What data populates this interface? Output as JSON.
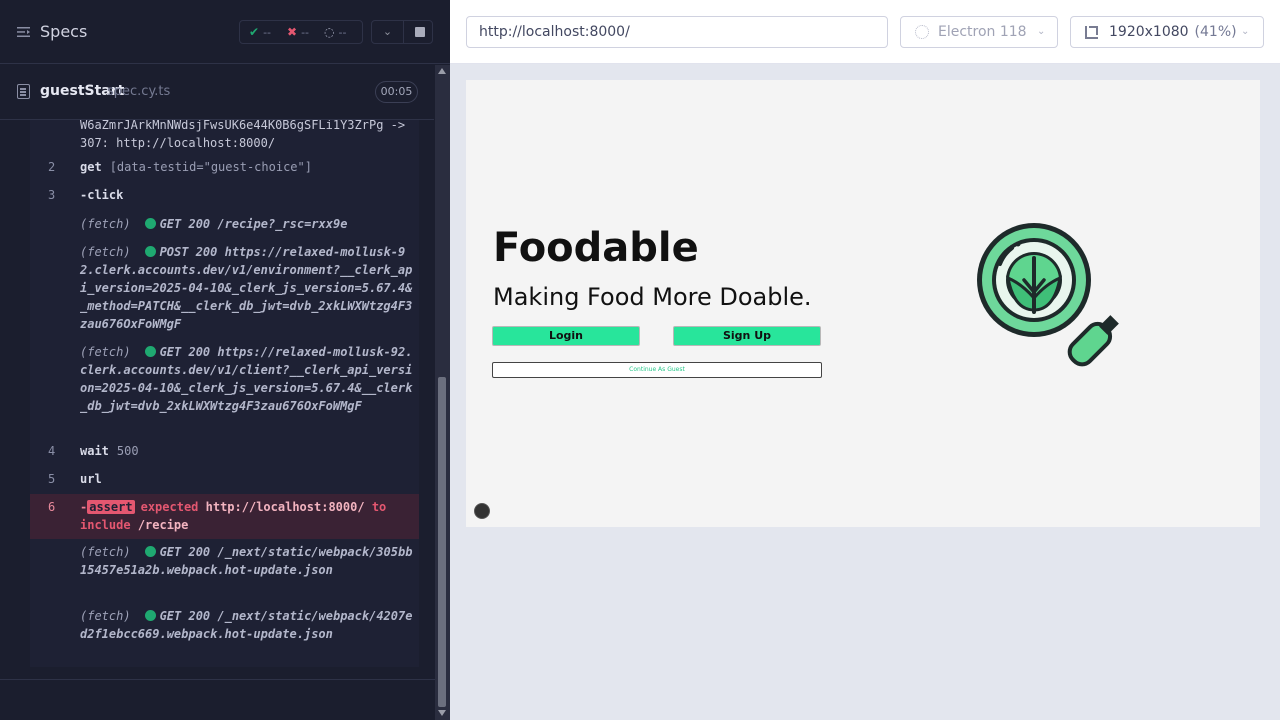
{
  "reporter": {
    "title": "Specs",
    "stats": {
      "passed": "--",
      "failed": "--",
      "pending": "--"
    },
    "file": {
      "name": "guestStart",
      "ext": "spec.cy.ts",
      "duration": "00:05"
    },
    "log": [
      {
        "num": "",
        "kind": "text",
        "text": "W6aZmrJArkMnNWdsjFwsUK6e44K0B6gSFLi1Y3ZrPg ->\n307: http://localhost:8000/"
      },
      {
        "num": "2",
        "kind": "cmd",
        "name": "get",
        "msg": "[data-testid=\"guest-choice\"]"
      },
      {
        "num": "3",
        "kind": "cmd",
        "name": "-click",
        "msg": ""
      },
      {
        "num": "",
        "kind": "fetch",
        "label": "(fetch)",
        "text": "GET 200 /recipe?_rsc=rxx9e"
      },
      {
        "num": "",
        "kind": "fetch",
        "label": "(fetch)",
        "text": "POST 200 https://relaxed-mollusk-92.clerk.accounts.dev/v1/environment?__clerk_api_version=2025-04-10&_clerk_js_version=5.67.4&_method=PATCH&__clerk_db_jwt=dvb_2xkLWXWtzg4F3zau676OxFoWMgF"
      },
      {
        "num": "",
        "kind": "fetch",
        "label": "(fetch)",
        "text": "GET 200 https://relaxed-mollusk-92.clerk.accounts.dev/v1/client?__clerk_api_version=2025-04-10&_clerk_js_version=5.67.4&__clerk_db_jwt=dvb_2xkLWXWtzg4F3zau676OxFoWMgF"
      },
      {
        "num": "4",
        "kind": "cmd",
        "name": "wait",
        "msg": "500"
      },
      {
        "num": "5",
        "kind": "cmd",
        "name": "url",
        "msg": ""
      },
      {
        "num": "6",
        "kind": "assert",
        "prefix": "-",
        "badge": "assert",
        "expected": "expected",
        "value": "http://localhost:8000/",
        "to": "to",
        "include": "include",
        "target": "/recipe"
      },
      {
        "num": "",
        "kind": "fetch",
        "label": "(fetch)",
        "text": "GET 200 /_next/static/webpack/305bb15457e51a2b.webpack.hot-update.json"
      },
      {
        "num": "",
        "kind": "fetch",
        "label": "(fetch)",
        "text": "GET 200 /_next/static/webpack/4207ed2f1ebcc669.webpack.hot-update.json"
      }
    ]
  },
  "toolbar": {
    "url": "http://localhost:8000/",
    "browser": "Electron 118",
    "viewport": "1920x1080",
    "zoom": "(41%)"
  },
  "app": {
    "brand": "Foodable",
    "tagline": "Making Food More Doable.",
    "login": "Login",
    "signup": "Sign Up",
    "guest": "Continue As Guest"
  },
  "colors": {
    "reporter_bg": "#1b1e2e",
    "pass": "#1fa971",
    "fail": "#e45770",
    "accent_button": "#28e59b"
  }
}
